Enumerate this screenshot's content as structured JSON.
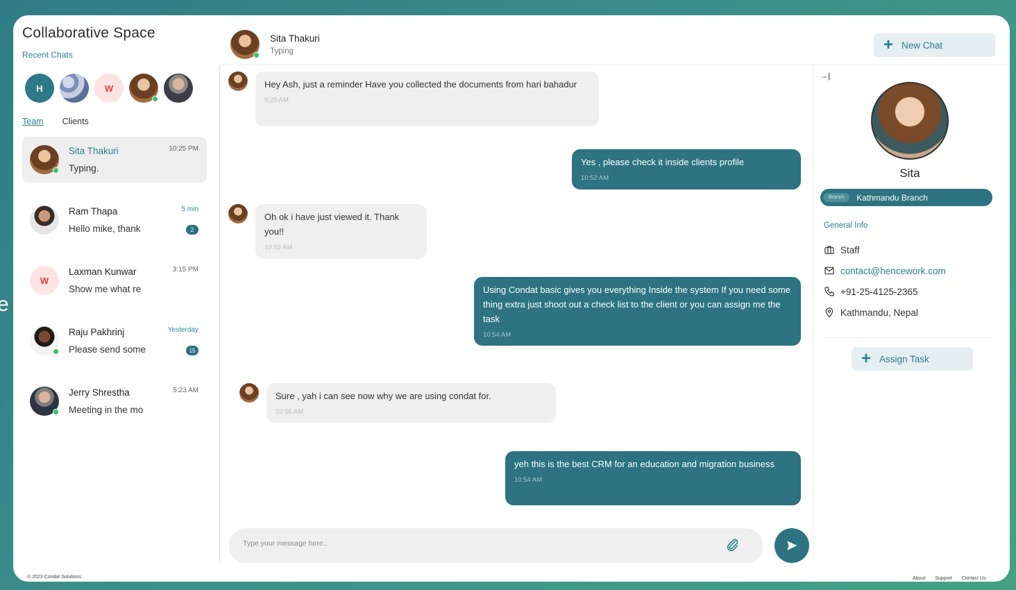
{
  "background_letter": "e",
  "app": {
    "title": "Collaborative Space",
    "recent_label": "Recent Chats"
  },
  "recent_avatars": [
    {
      "initial": "H",
      "kind": "initial"
    },
    {
      "initial": "",
      "kind": "flower"
    },
    {
      "initial": "W",
      "kind": "initial-w"
    },
    {
      "initial": "",
      "kind": "photo-f",
      "online": true
    },
    {
      "initial": "",
      "kind": "photo-m"
    }
  ],
  "tabs": {
    "team": "Team",
    "clients": "Clients"
  },
  "chats": [
    {
      "name": "Sita Thakuri",
      "preview": "Typing.",
      "time": "10:25 PM",
      "active": true
    },
    {
      "name": "Ram Thapa",
      "preview": "Hello mike, thank",
      "time": "5 min",
      "unread": "2"
    },
    {
      "name": "Laxman Kunwar",
      "preview": "Show me what re",
      "time": "3:15 PM",
      "initial": "W"
    },
    {
      "name": "Raju Pakhrinj",
      "preview": "Please send some",
      "time": "Yesterday",
      "unread": "15"
    },
    {
      "name": "Jerry Shrestha",
      "preview": "Meeting in the mo",
      "time": "5:23 AM"
    }
  ],
  "header": {
    "name": "Sita Thakuri",
    "status": "Typing",
    "new_chat": "New Chat"
  },
  "messages": [
    {
      "dir": "in",
      "text": "Hey Ash, just a reminder Have you collected the documents from hari bahadur",
      "time": "9:20 AM"
    },
    {
      "dir": "out",
      "text": "Yes , please check it inside clients profile",
      "time": "10:52 AM"
    },
    {
      "dir": "in",
      "text": "Oh ok i have just viewed it. Thank you!!",
      "time": "10:53 AM"
    },
    {
      "dir": "out",
      "text": "Using Condat basic gives you everything Inside  the system If you need some thing extra just shoot out a check list to the client or you can assign me the task",
      "time": "10:54 AM"
    },
    {
      "dir": "in",
      "text": "Sure , yah i can see now why we are using condat for.",
      "time": "10:55 AM"
    },
    {
      "dir": "out",
      "text": "yeh this is the best CRM for an education and migration business",
      "time": "10:54 AM"
    }
  ],
  "composer": {
    "placeholder": "Type your message here.."
  },
  "profile": {
    "collapse_glyph": "→|",
    "name": "Sita",
    "branch_tag": "Branch",
    "branch": "Kathmandu Branch",
    "general_info": "General Info",
    "role": "Staff",
    "email": "contact@hencework.com",
    "phone": "+91-25-4125-2365",
    "location": "Kathmandu, Nepal",
    "assign_task": "Assign Task"
  },
  "footer": {
    "copyright": "© 2023 Condat Solutions",
    "about": "About",
    "support": "Support",
    "contact": "Contact Us"
  },
  "colors": {
    "accent": "#2a7f8c",
    "bubble_out": "#2d7381",
    "bubble_in": "#efefef",
    "online": "#33c26a"
  }
}
